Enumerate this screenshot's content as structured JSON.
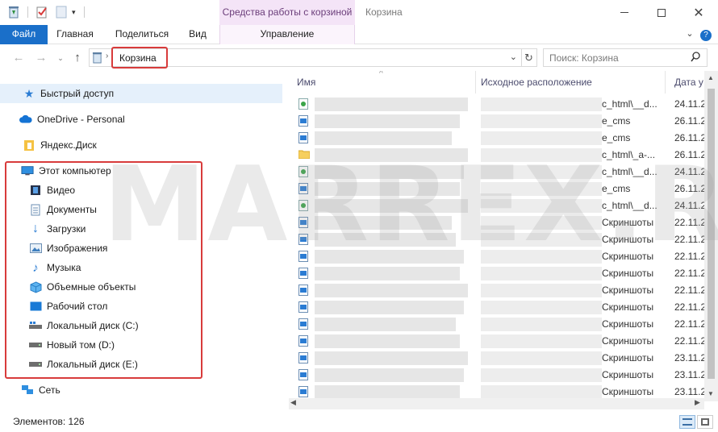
{
  "titlebar": {
    "context_tab": "Средства работы с корзиной",
    "window_title": "Корзина"
  },
  "ribbon": {
    "tabs": [
      "Файл",
      "Главная",
      "Поделиться",
      "Вид",
      "Управление"
    ]
  },
  "address": {
    "location": "Корзина",
    "search_placeholder": "Поиск: Корзина"
  },
  "navigation": {
    "items": [
      {
        "label": "Быстрый доступ",
        "icon": "star-icon"
      },
      {
        "label": "OneDrive - Personal",
        "icon": "cloud-icon"
      },
      {
        "label": "Яндекс.Диск",
        "icon": "yandex-disk-icon"
      },
      {
        "label": "Этот компьютер",
        "icon": "computer-icon"
      },
      {
        "label": "Видео",
        "icon": "video-icon"
      },
      {
        "label": "Документы",
        "icon": "documents-icon"
      },
      {
        "label": "Загрузки",
        "icon": "download-icon"
      },
      {
        "label": "Изображения",
        "icon": "pictures-icon"
      },
      {
        "label": "Музыка",
        "icon": "music-icon"
      },
      {
        "label": "Объемные объекты",
        "icon": "3d-objects-icon"
      },
      {
        "label": "Рабочий стол",
        "icon": "desktop-icon"
      },
      {
        "label": "Локальный диск (C:)",
        "icon": "drive-c-icon"
      },
      {
        "label": "Новый том (D:)",
        "icon": "drive-icon"
      },
      {
        "label": "Локальный диск (E:)",
        "icon": "drive-icon"
      },
      {
        "label": "Сеть",
        "icon": "network-icon"
      }
    ]
  },
  "filelist": {
    "columns": [
      "Имя",
      "Исходное расположение",
      "Дата у"
    ],
    "rows": [
      {
        "location": "c_html\\__d...",
        "date": "24.11.2",
        "icon": "html-file-icon"
      },
      {
        "location": "e_cms",
        "date": "26.11.2",
        "icon": "image-file-icon"
      },
      {
        "location": "e_cms",
        "date": "26.11.2",
        "icon": "image-file-icon"
      },
      {
        "location": "c_html\\_a-...",
        "date": "26.11.2",
        "icon": "folder-icon"
      },
      {
        "location": "c_html\\__d...",
        "date": "24.11.2",
        "icon": "html-file-icon"
      },
      {
        "location": "e_cms",
        "date": "26.11.2",
        "icon": "image-file-icon"
      },
      {
        "location": "c_html\\__d...",
        "date": "24.11.2",
        "icon": "html-file-icon"
      },
      {
        "location": "Скриншоты",
        "date": "22.11.2",
        "icon": "image-file-icon"
      },
      {
        "location": "Скриншоты",
        "date": "22.11.2",
        "icon": "image-file-icon"
      },
      {
        "location": "Скриншоты",
        "date": "22.11.2",
        "icon": "image-file-icon"
      },
      {
        "location": "Скриншоты",
        "date": "22.11.2",
        "icon": "image-file-icon"
      },
      {
        "location": "Скриншоты",
        "date": "22.11.2",
        "icon": "image-file-icon"
      },
      {
        "location": "Скриншоты",
        "date": "22.11.2",
        "icon": "image-file-icon"
      },
      {
        "location": "Скриншоты",
        "date": "22.11.2",
        "icon": "image-file-icon"
      },
      {
        "location": "Скриншоты",
        "date": "22.11.2",
        "icon": "image-file-icon"
      },
      {
        "location": "Скриншоты",
        "date": "23.11.2",
        "icon": "image-file-icon"
      },
      {
        "location": "Скриншоты",
        "date": "23.11.2",
        "icon": "image-file-icon"
      },
      {
        "location": "Скриншоты",
        "date": "23.11.2",
        "icon": "image-file-icon"
      }
    ]
  },
  "status": {
    "count": "Элементов: 126"
  },
  "watermark": "MARREX.RU",
  "colors": {
    "accent": "#1a6fc9",
    "context_tab": "#f4e4f7",
    "highlight": "#d83b3b",
    "selection": "#e5f0fb"
  }
}
